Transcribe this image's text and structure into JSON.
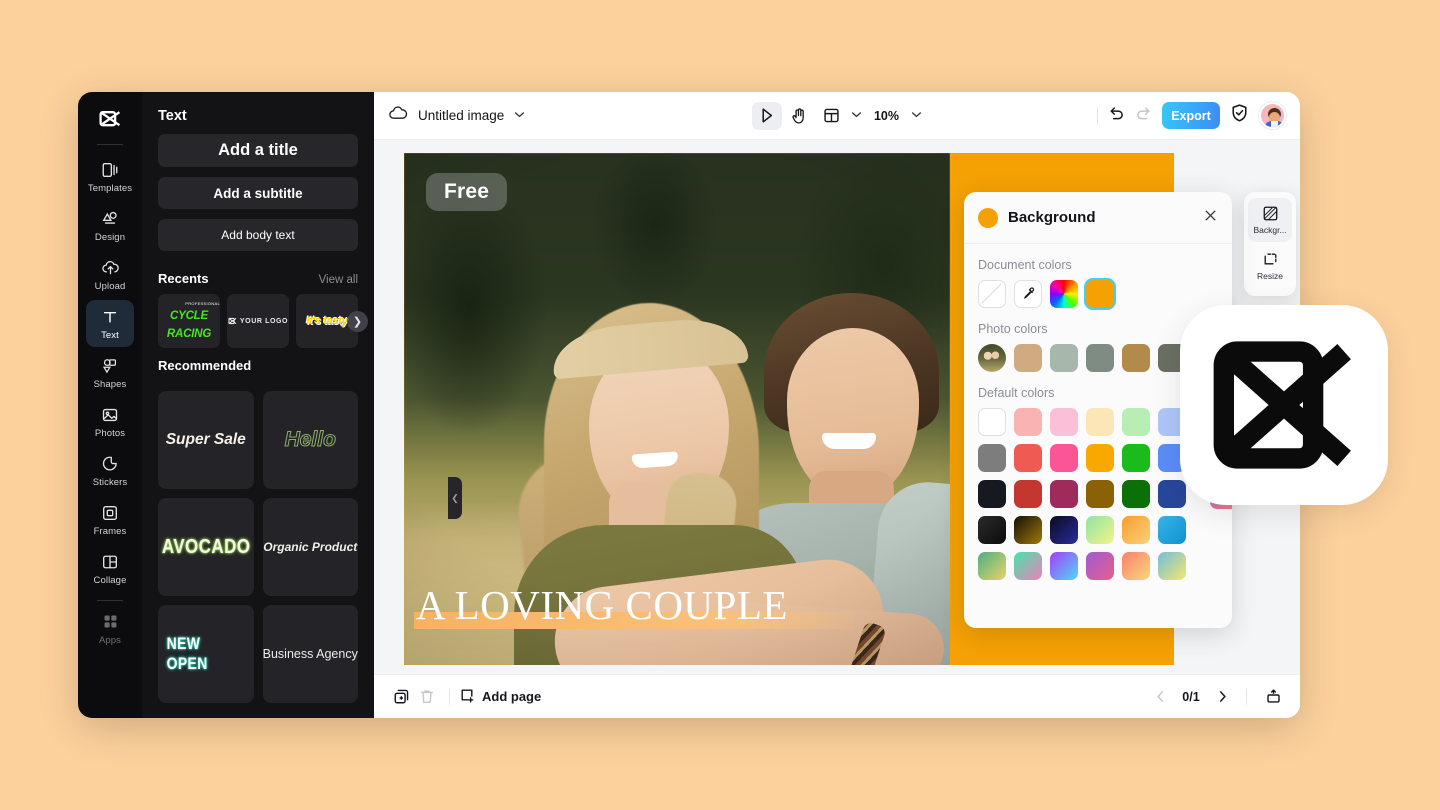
{
  "app": {
    "logo": "capcut-logo"
  },
  "rail": {
    "items": [
      {
        "label": "Templates",
        "icon": "templates-icon",
        "active": false
      },
      {
        "label": "Design",
        "icon": "design-icon",
        "active": false
      },
      {
        "label": "Upload",
        "icon": "upload-icon",
        "active": false
      },
      {
        "label": "Text",
        "icon": "text-icon",
        "active": true
      },
      {
        "label": "Shapes",
        "icon": "shapes-icon",
        "active": false
      },
      {
        "label": "Photos",
        "icon": "photos-icon",
        "active": false
      },
      {
        "label": "Stickers",
        "icon": "stickers-icon",
        "active": false
      },
      {
        "label": "Frames",
        "icon": "frames-icon",
        "active": false
      },
      {
        "label": "Collage",
        "icon": "collage-icon",
        "active": false
      },
      {
        "label": "Apps",
        "icon": "apps-icon",
        "active": false
      }
    ]
  },
  "text_panel": {
    "title": "Text",
    "add_title": "Add a title",
    "add_subtitle": "Add a subtitle",
    "add_body": "Add body text",
    "recents_label": "Recents",
    "view_all": "View all",
    "recents": [
      {
        "name": "CYCLE RACING",
        "sup": "PROFESSIONAL"
      },
      {
        "name": "YOUR LOGO"
      },
      {
        "name": "It's tasty"
      }
    ],
    "recommended_label": "Recommended",
    "recommended": [
      {
        "name": "Super Sale"
      },
      {
        "name": "Hello"
      },
      {
        "name": "AVOCADO"
      },
      {
        "name": "Organic Product"
      },
      {
        "name": "NEW OPEN"
      },
      {
        "name": "Business Agency"
      }
    ]
  },
  "topbar": {
    "cloud_icon": "cloud-icon",
    "doc_title": "Untitled image",
    "title_chevron": "chevron-down-icon",
    "tools": [
      {
        "name": "select-tool",
        "icon": "cursor-icon",
        "selected": true
      },
      {
        "name": "hand-tool",
        "icon": "hand-icon",
        "selected": false
      },
      {
        "name": "layout-tool",
        "icon": "layout-icon",
        "selected": false
      }
    ],
    "zoom": "10%",
    "zoom_chevron": "chevron-down-icon",
    "undo": "undo-icon",
    "redo": "redo-icon",
    "export_label": "Export",
    "shield_icon": "shield-check-icon",
    "avatar": "user-avatar"
  },
  "canvas": {
    "background_color": "#f5a104",
    "badge_text": "Free",
    "title_text": "A LOVING COUPLE",
    "title_highlight_color": "#f7b25f"
  },
  "bottombar": {
    "duplicate_icon": "duplicate-page-icon",
    "delete_icon": "trash-icon",
    "add_page_label": "Add page",
    "add_page_icon": "add-page-icon",
    "prev_icon": "chevron-left-icon",
    "page_count": "0/1",
    "next_icon": "chevron-right-icon",
    "present_icon": "present-icon"
  },
  "bg_panel": {
    "title": "Background",
    "swatch_color": "#f5a104",
    "close_icon": "close-icon",
    "document_colors_label": "Document colors",
    "document_colors": [
      {
        "name": "transparent-swatch",
        "color": "none",
        "selected": false
      },
      {
        "name": "eyedropper-swatch",
        "color": "none",
        "selected": false
      },
      {
        "name": "color-wheel-swatch",
        "color": "rainbow",
        "selected": false
      },
      {
        "name": "orange-swatch",
        "color": "#f5a104",
        "selected": true
      }
    ],
    "photo_colors_label": "Photo colors",
    "photo_colors": [
      "#d0ab82",
      "#a8b7ad",
      "#7f8c83",
      "#b28b4a",
      "#697062"
    ],
    "default_colors_label": "Default colors",
    "default_colors": [
      [
        "#ffffff",
        "#f9b3b3",
        "#fbc0d8",
        "#fbe6b8",
        "#b8eeb4",
        "#aec6f8"
      ],
      [
        "#7d7d7d",
        "#ef5a52",
        "#fb5596",
        "#f9a800",
        "#1cbb1c",
        "#5b8df7"
      ],
      [
        "#171920",
        "#c43630",
        "#9e2b5c",
        "#8a6104",
        "#0c7009",
        "#27479c"
      ],
      [
        "linear-gradient(135deg,#2b2b2b,#0b0b0b)",
        "linear-gradient(135deg,#121007,#a27a08)",
        "linear-gradient(135deg,#0b0b1f,#2b2b9e)",
        "linear-gradient(135deg,#8fe3a3,#f2f58a)",
        "linear-gradient(135deg,#f79c2f,#fbd37a)",
        "linear-gradient(135deg,#37b3e8,#0f92d0)",
        "linear-gradient(135deg,#aec6f8,#d3b8f0)"
      ],
      [
        "linear-gradient(135deg,#4fae84,#e6d468)",
        "linear-gradient(135deg,#41e6a8,#f07fbb)",
        "linear-gradient(135deg,#a33df5,#4fd8f7)",
        "linear-gradient(135deg,#a05ad4,#e4618a)",
        "linear-gradient(135deg,#fb7f6d,#f9d87a)",
        "linear-gradient(135deg,#74bde0,#f2e86a)",
        "linear-gradient(135deg,#b06fd0,#f07d7d)"
      ]
    ]
  },
  "tool_dock": {
    "items": [
      {
        "label": "Backgr...",
        "icon": "background-icon",
        "active": true
      },
      {
        "label": "Resize",
        "icon": "resize-icon",
        "active": false
      }
    ]
  }
}
